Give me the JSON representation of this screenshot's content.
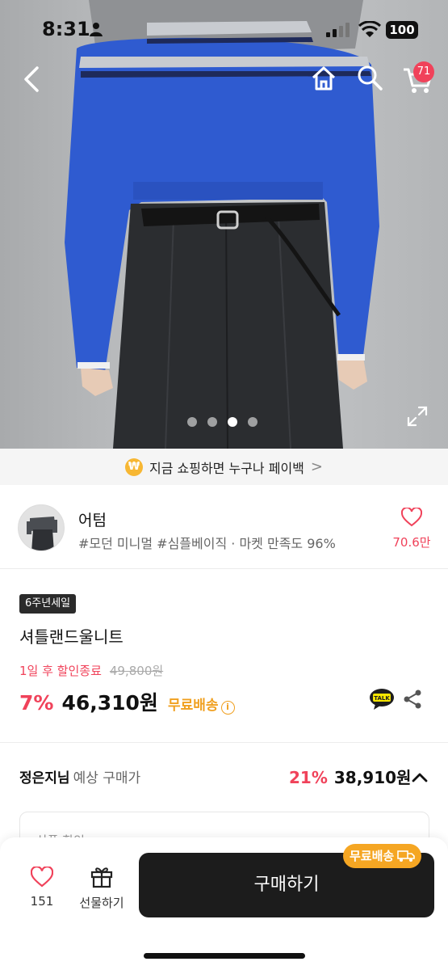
{
  "status_bar": {
    "time": "8:31",
    "battery": "100"
  },
  "header": {
    "cart_count": "71"
  },
  "gallery": {
    "total_slides": 4,
    "active_slide": 3
  },
  "payback_banner": {
    "coin": "₩",
    "text": "지금 쇼핑하면 누구나 페이백",
    "chevron": ">"
  },
  "seller": {
    "name": "어텀",
    "tags": "#모던 미니멀 #심플베이직 · 마켓 만족도 96%",
    "likes": "70.6만"
  },
  "product": {
    "badge": "6주년세일",
    "name": "셔틀랜드울니트",
    "discount_end": "1일 후 할인종료",
    "original_price": "49,800원",
    "discount_rate": "7%",
    "price": "46,310원",
    "shipping": "무료배송",
    "info_icon": "i"
  },
  "member_price": {
    "name": "정은지님",
    "label": "예상 구매가",
    "discount_rate": "21%",
    "price": "38,910원"
  },
  "coupon": {
    "label": "상품 할인"
  },
  "bottom_bar": {
    "wish_count": "151",
    "gift_label": "선물하기",
    "buy_label": "구매하기",
    "free_shipping_tag": "무료배송"
  },
  "colors": {
    "accent": "#f0425a",
    "shipping": "#f0a020",
    "buy_button": "#1c1c1c"
  }
}
